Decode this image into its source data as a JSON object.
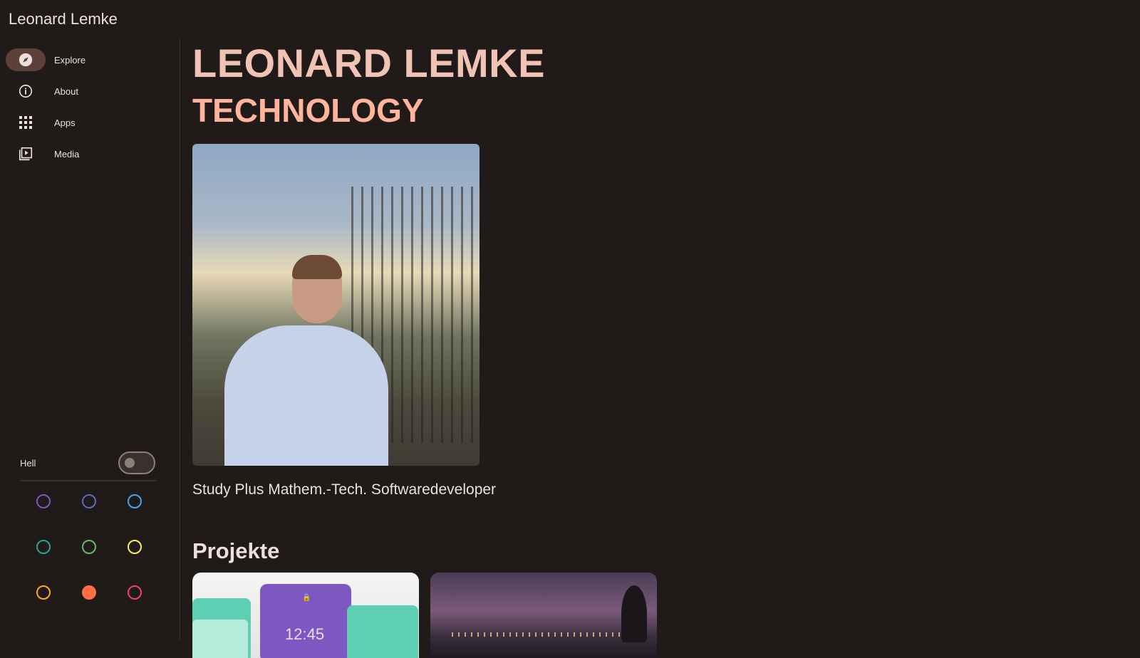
{
  "app": {
    "title": "Leonard Lemke"
  },
  "sidebar": {
    "items": [
      {
        "label": "Explore",
        "icon": "compass-icon",
        "active": true
      },
      {
        "label": "About",
        "icon": "info-icon",
        "active": false
      },
      {
        "label": "Apps",
        "icon": "apps-grid-icon",
        "active": false
      },
      {
        "label": "Media",
        "icon": "media-library-icon",
        "active": false
      }
    ],
    "theme_toggle": {
      "label": "Hell",
      "checked": false
    },
    "color_swatches": [
      {
        "color": "#7e57c2",
        "selected": false
      },
      {
        "color": "#5c6bc0",
        "selected": false
      },
      {
        "color": "#42a5f5",
        "selected": false
      },
      {
        "color": "#26a69a",
        "selected": false
      },
      {
        "color": "#66bb6a",
        "selected": false
      },
      {
        "color": "#ffee58",
        "selected": false
      },
      {
        "color": "#ffa726",
        "selected": false
      },
      {
        "color": "#ff7043",
        "selected": true
      },
      {
        "color": "#ec407a",
        "selected": false
      }
    ]
  },
  "main": {
    "hero_name": "LEONARD LEMKE",
    "hero_subtitle": "TECHNOLOGY",
    "tagline": "Study Plus Mathem.-Tech. Softwaredeveloper",
    "projects_title": "Projekte",
    "project_card_1": {
      "clock": "12:45"
    }
  },
  "colors": {
    "background": "#201a18",
    "accent": "#ffb59d",
    "active_nav": "#5d4037"
  }
}
